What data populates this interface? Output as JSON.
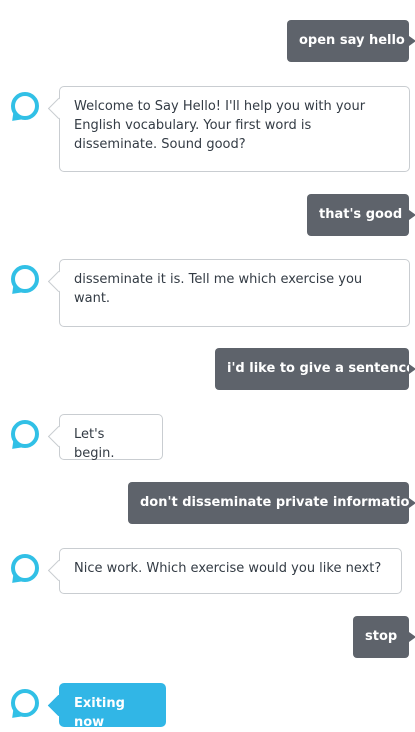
{
  "messages": [
    {
      "role": "user",
      "text": "open say hello"
    },
    {
      "role": "alexa",
      "text": "Welcome to Say Hello! I'll help you with your English vocabulary. Your first word is disseminate. Sound good?"
    },
    {
      "role": "user",
      "text": "that's good"
    },
    {
      "role": "alexa",
      "text": "disseminate it is. Tell me which exercise you want."
    },
    {
      "role": "user",
      "text": "i'd like to give a sentence"
    },
    {
      "role": "alexa",
      "text": "Let's begin."
    },
    {
      "role": "user",
      "text": "don't disseminate private information"
    },
    {
      "role": "alexa",
      "text": "Nice work. Which exercise would you like next?"
    },
    {
      "role": "user",
      "text": "stop"
    },
    {
      "role": "alexa",
      "text": "Exiting now"
    }
  ],
  "colors": {
    "user_bubble": "#5e636b",
    "alexa_ring": "#31c0e6",
    "exit_bubble": "#31b6e6",
    "alexa_border": "#c9cdd1"
  },
  "icons": {
    "alexa_avatar": "alexa-ring-icon"
  }
}
